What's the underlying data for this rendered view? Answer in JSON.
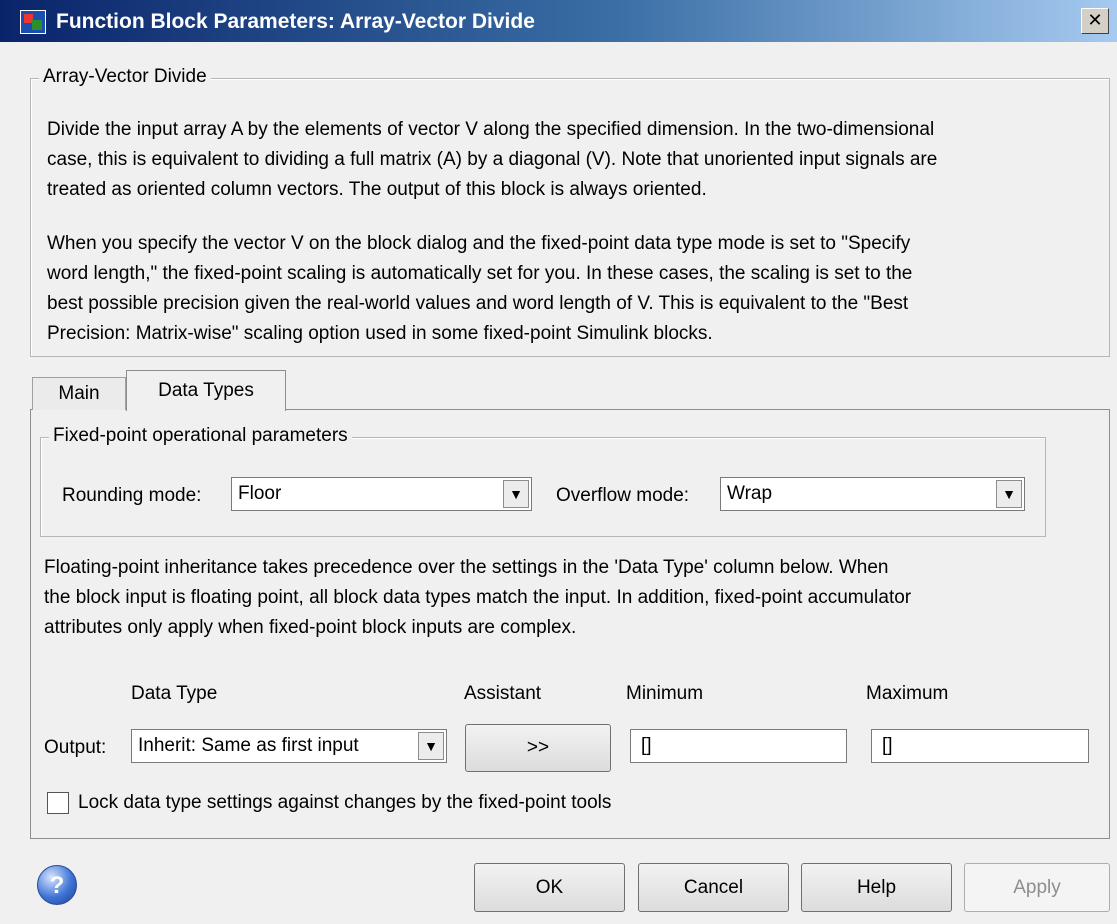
{
  "window": {
    "title": "Function Block Parameters: Array-Vector Divide",
    "close_glyph": "✕"
  },
  "description": {
    "group_title": "Array-Vector Divide",
    "paragraph1_lines": [
      "Divide the input array A by the elements of vector V along the specified dimension.  In the two-dimensional",
      "case, this is equivalent to dividing a full matrix (A) by a diagonal (V). Note that unoriented input signals are",
      "treated as oriented column vectors. The output of this block is always oriented."
    ],
    "paragraph2_lines": [
      "When you specify the vector V on the block dialog and the fixed-point data type mode is set to \"Specify",
      "word length,\" the fixed-point scaling is automatically set for you. In these cases, the scaling is set to the",
      "best possible precision given the real-world values and word length of V. This is equivalent to the \"Best",
      "Precision: Matrix-wise\" scaling option used in some fixed-point Simulink blocks."
    ]
  },
  "tabs": [
    {
      "label": "Main",
      "active": false
    },
    {
      "label": "Data Types",
      "active": true
    }
  ],
  "fixed_point": {
    "group_title": "Fixed-point operational parameters",
    "rounding_label": "Rounding mode:",
    "rounding_value": "Floor",
    "overflow_label": "Overflow mode:",
    "overflow_value": "Wrap"
  },
  "inheritance_note_lines": [
    "Floating-point inheritance takes precedence over the settings in the 'Data Type' column below. When",
    "the block input is floating point, all block data types match the input. In addition, fixed-point accumulator",
    "attributes only apply when fixed-point block inputs are complex."
  ],
  "datatype_table": {
    "headers": {
      "data_type": "Data Type",
      "assistant": "Assistant",
      "minimum": "Minimum",
      "maximum": "Maximum"
    },
    "rows": [
      {
        "label": "Output:",
        "data_type": "Inherit: Same as first input",
        "assistant_button": ">>",
        "minimum": "[]",
        "maximum": "[]"
      }
    ]
  },
  "lock_checkbox": {
    "label": "Lock data type settings against changes by the fixed-point tools",
    "checked": false
  },
  "buttons": {
    "ok": "OK",
    "cancel": "Cancel",
    "help": "Help",
    "apply": "Apply",
    "help_icon_glyph": "?"
  },
  "dropdown_arrow": "▼"
}
